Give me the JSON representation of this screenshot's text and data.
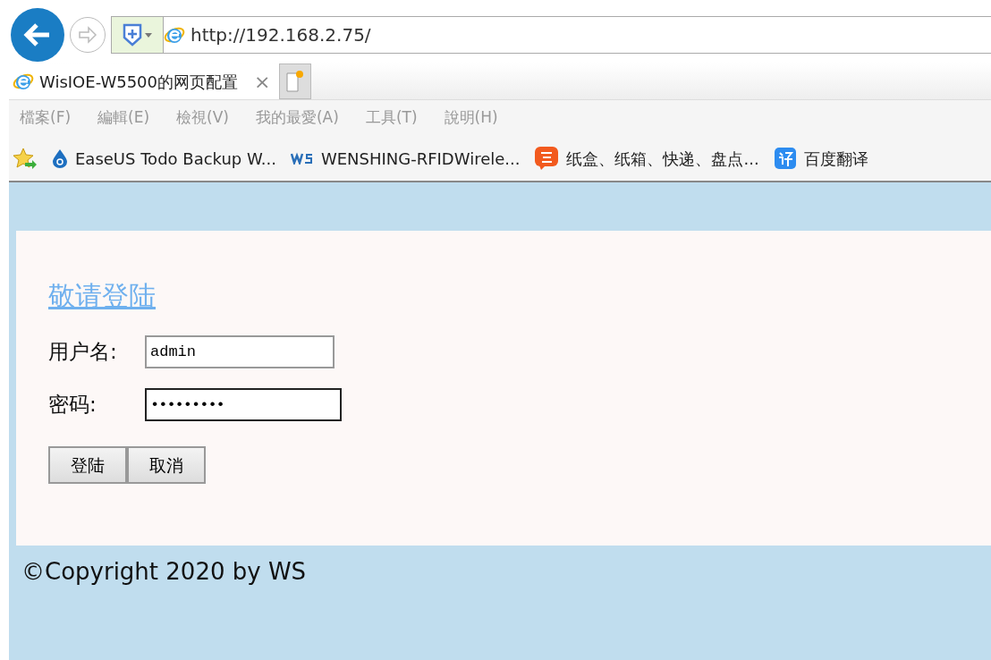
{
  "browser": {
    "address": "http://192.168.2.75/",
    "tabs": [
      {
        "title": "WisIOE-W5500的网页配置",
        "close": "×",
        "selected": true
      }
    ],
    "menu": [
      "檔案(F)",
      "編輯(E)",
      "檢視(V)",
      "我的最愛(A)",
      "工具(T)",
      "說明(H)"
    ],
    "favorites": [
      {
        "label": "EaseUS Todo Backup W...",
        "kind": "easeus"
      },
      {
        "label": "WENSHING-RFIDWirele...",
        "kind": "ws"
      },
      {
        "label": "纸盒、纸箱、快递、盘点...",
        "kind": "tao"
      },
      {
        "label": "百度翻译",
        "kind": "translate"
      }
    ]
  },
  "page": {
    "title": "敬请登陆",
    "fields": [
      {
        "label": "用户名:",
        "value": "admin",
        "kind": "text"
      },
      {
        "label": "密码:",
        "value": "•••••••••",
        "kind": "password"
      }
    ],
    "buttons": [
      "登陆",
      "取消"
    ],
    "footer": "©Copyright 2020 by WS"
  }
}
